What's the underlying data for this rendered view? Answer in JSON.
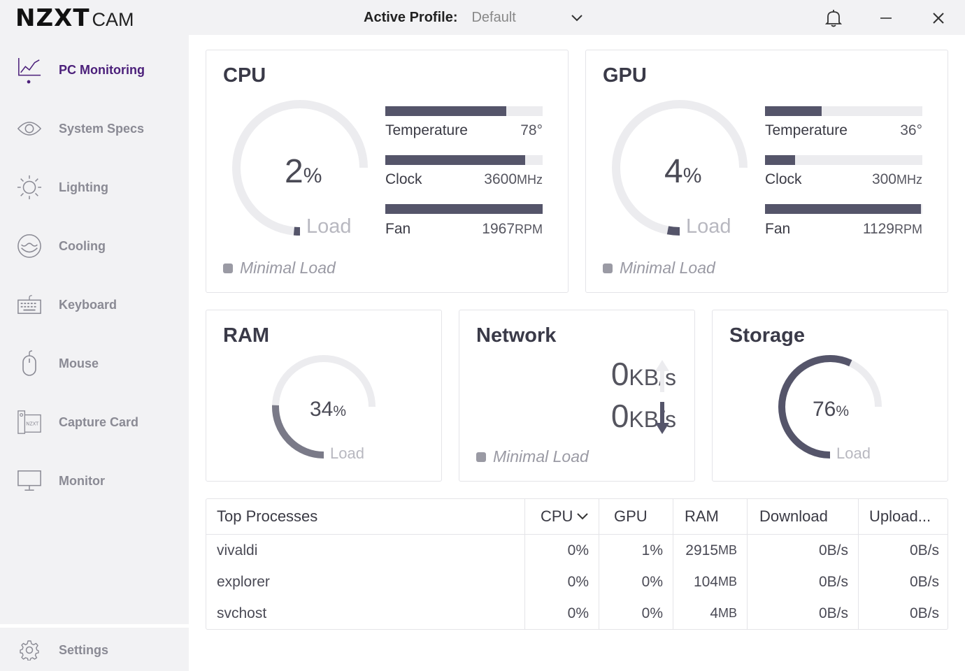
{
  "app": {
    "logo_main": "NZXT",
    "logo_sub": "CAM"
  },
  "header": {
    "profile_label": "Active Profile:",
    "profile_value": "Default"
  },
  "sidebar": {
    "items": [
      {
        "label": "PC Monitoring",
        "icon": "chart-line-icon",
        "active": true
      },
      {
        "label": "System Specs",
        "icon": "eye-icon"
      },
      {
        "label": "Lighting",
        "icon": "sun-icon"
      },
      {
        "label": "Cooling",
        "icon": "water-bowl-icon"
      },
      {
        "label": "Keyboard",
        "icon": "keyboard-icon"
      },
      {
        "label": "Mouse",
        "icon": "mouse-icon"
      },
      {
        "label": "Capture Card",
        "icon": "capture-card-icon"
      },
      {
        "label": "Monitor",
        "icon": "monitor-icon"
      }
    ],
    "settings_label": "Settings"
  },
  "cpu": {
    "title": "CPU",
    "load_value": "2",
    "load_unit": "%",
    "load_fraction": 0.02,
    "load_label": "Load",
    "temperature_label": "Temperature",
    "temperature_value": "78°",
    "temperature_fill": 0.77,
    "clock_label": "Clock",
    "clock_value": "3600",
    "clock_unit": "MHz",
    "clock_fill": 0.89,
    "fan_label": "Fan",
    "fan_value": "1967",
    "fan_unit": "RPM",
    "fan_fill": 1.0,
    "status": "Minimal Load"
  },
  "gpu": {
    "title": "GPU",
    "load_value": "4",
    "load_unit": "%",
    "load_fraction": 0.04,
    "load_label": "Load",
    "temperature_label": "Temperature",
    "temperature_value": "36°",
    "temperature_fill": 0.36,
    "clock_label": "Clock",
    "clock_value": "300",
    "clock_unit": "MHz",
    "clock_fill": 0.19,
    "fan_label": "Fan",
    "fan_value": "1129",
    "fan_unit": "RPM",
    "fan_fill": 0.99,
    "status": "Minimal Load"
  },
  "ram": {
    "title": "RAM",
    "value": "34",
    "unit": "%",
    "fraction": 0.34,
    "label": "Load"
  },
  "network": {
    "title": "Network",
    "upload_value": "0",
    "upload_unit": "KB/s",
    "download_value": "0",
    "download_unit": "KB/s",
    "status": "Minimal Load"
  },
  "storage": {
    "title": "Storage",
    "value": "76",
    "unit": "%",
    "fraction": 0.76,
    "label": "Load"
  },
  "processes": {
    "headers": {
      "name": "Top Processes",
      "cpu": "CPU",
      "gpu": "GPU",
      "ram": "RAM",
      "download": "Download",
      "upload": "Upload..."
    },
    "rows": [
      {
        "name": "vivaldi",
        "cpu": "0%",
        "gpu": "1%",
        "ram": "2915",
        "ram_unit": "MB",
        "download": "0B/s",
        "upload": "0B/s"
      },
      {
        "name": "explorer",
        "cpu": "0%",
        "gpu": "0%",
        "ram": "104",
        "ram_unit": "MB",
        "download": "0B/s",
        "upload": "0B/s"
      },
      {
        "name": "svchost",
        "cpu": "0%",
        "gpu": "0%",
        "ram": "4",
        "ram_unit": "MB",
        "download": "0B/s",
        "upload": "0B/s"
      }
    ]
  },
  "colors": {
    "accent": "#4b1f7a",
    "bar_fill": "#55556a",
    "track": "#ececef"
  }
}
